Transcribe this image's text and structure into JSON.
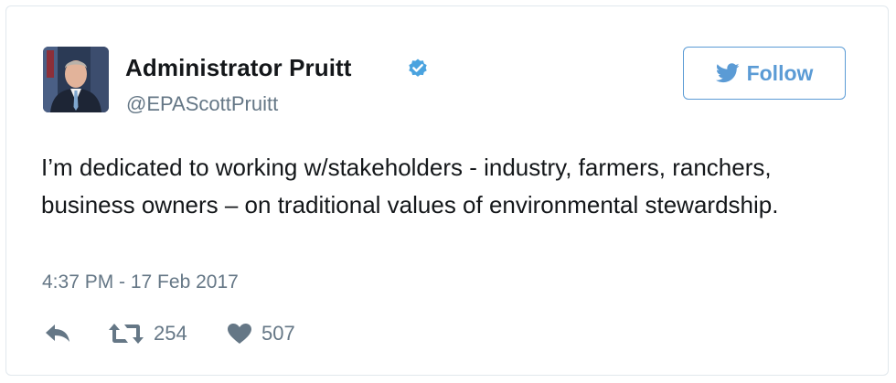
{
  "tweet": {
    "author": {
      "display_name": "Administrator Pruitt",
      "screen_name": "@EPAScottPruitt",
      "verified": true,
      "avatar_icon": "portrait-photo"
    },
    "follow_button": {
      "label": "Follow",
      "icon": "twitter-bird-icon"
    },
    "text": "I’m dedicated to working w/stakeholders - industry, farmers, ranchers, business owners – on traditional values of environmental stewardship.",
    "timestamp": "4:37 PM - 17 Feb 2017",
    "actions": {
      "reply": {
        "icon": "reply-icon"
      },
      "retweet": {
        "icon": "retweet-icon",
        "count": "254"
      },
      "like": {
        "icon": "heart-icon",
        "count": "507"
      }
    },
    "colors": {
      "accent": "#5b9bd5",
      "verified": "#4aa3df",
      "muted": "#657786",
      "text": "#14171a",
      "border": "#e1e8ed"
    }
  }
}
